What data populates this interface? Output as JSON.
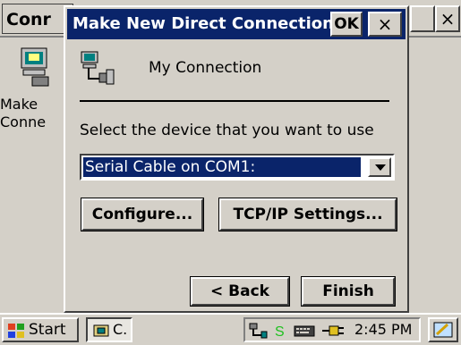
{
  "background_window": {
    "title": "Conr",
    "btn_x_label": "×",
    "desktop_icon_label": "Make\nConne"
  },
  "dialog": {
    "title": "Make New Direct Connection",
    "ok_label": "OK",
    "close_label": "×",
    "connection_name": "My Connection",
    "prompt": "Select the device that you want to use",
    "device": {
      "selected": "Serial Cable on COM1:"
    },
    "configure_label": "Configure...",
    "tcpip_label": "TCP/IP Settings...",
    "back_label": "< Back",
    "finish_label": "Finish"
  },
  "taskbar": {
    "start_label": "Start",
    "task_label": "C.",
    "time": "2:45 PM",
    "tray_icons": [
      "network-icon",
      "sync-icon",
      "keyboard-icon",
      "power-icon"
    ]
  },
  "colors": {
    "titlebar": "#0a246a",
    "face": "#d4d0c8",
    "selection": "#0a246a"
  }
}
